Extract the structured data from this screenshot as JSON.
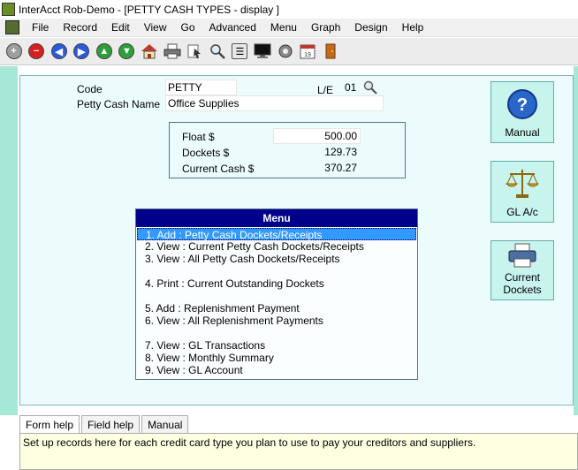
{
  "window": {
    "title": "InterAcct Rob-Demo - [PETTY CASH TYPES - display ]"
  },
  "menubar": [
    "File",
    "Record",
    "Edit",
    "View",
    "Go",
    "Advanced",
    "Menu",
    "Graph",
    "Design",
    "Help"
  ],
  "toolbar": {
    "icons": [
      "add-icon",
      "delete-icon",
      "previous-icon",
      "next-icon",
      "up-icon",
      "down-icon",
      "home-icon",
      "print-icon",
      "pointer-icon",
      "search-icon",
      "list-icon",
      "screen-icon",
      "settings-icon",
      "calendar-icon",
      "exit-door-icon"
    ],
    "colors": {
      "add": "#9e9e9e",
      "delete": "#d62020",
      "nav": "#2a5bd7",
      "updown": "#2e9e3a"
    }
  },
  "form": {
    "code_label": "Code",
    "code_value": "PETTY",
    "le_label": "L/E",
    "le_value": "01",
    "name_label": "Petty Cash Name",
    "name_value": "Office Supplies",
    "float_label": "Float $",
    "float_value": "500.00",
    "dockets_label": "Dockets $",
    "dockets_value": "129.73",
    "current_cash_label": "Current Cash $",
    "current_cash_value": "370.27"
  },
  "menu": {
    "title": "Menu",
    "items": [
      "1. Add : Petty Cash Dockets/Receipts",
      "2. View : Current Petty Cash Dockets/Receipts",
      "3. View : All Petty Cash Dockets/Receipts",
      "4. Print : Current Outstanding Dockets",
      "5. Add : Replenishment Payment",
      "6. View : All Replenishment Payments",
      "7. View : GL Transactions",
      "8. View : Monthly Summary",
      "9. View : GL Account"
    ],
    "selected_index": 0
  },
  "side_buttons": {
    "manual": "Manual",
    "gl_ac": "GL A/c",
    "current_dockets_line1": "Current",
    "current_dockets_line2": "Dockets"
  },
  "help_tabs": [
    "Form help",
    "Field help",
    "Manual"
  ],
  "help_text": "Set up records here for each credit card type you plan to use to pay your creditors and suppliers.",
  "colors": {
    "panel_bg": "#ecfcfc",
    "strip": "#a6e8d6",
    "menu_header": "#00008b",
    "selection": "#3399ff",
    "help_bg": "#ffffe1"
  }
}
